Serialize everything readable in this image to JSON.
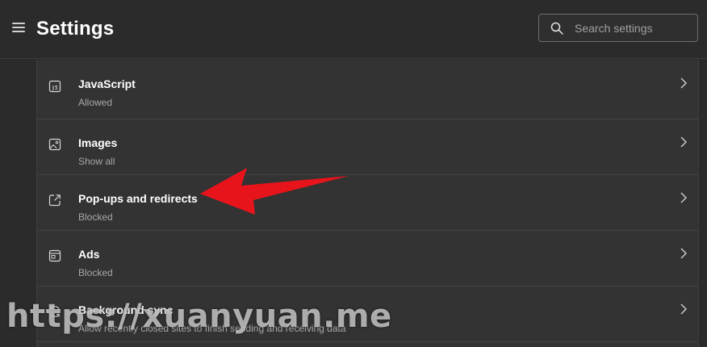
{
  "header": {
    "title": "Settings",
    "search_placeholder": "Search settings",
    "search_value": ""
  },
  "rows": [
    {
      "title": "JavaScript",
      "status": "Allowed",
      "icon": "javascript-icon"
    },
    {
      "title": "Images",
      "status": "Show all",
      "icon": "image-icon"
    },
    {
      "title": "Pop-ups and redirects",
      "status": "Blocked",
      "icon": "popup-redirect-icon"
    },
    {
      "title": "Ads",
      "status": "Blocked",
      "icon": "ads-icon"
    },
    {
      "title": "Background sync",
      "status": "Allow recently closed sites to finish sending and receiving data",
      "icon": "sync-icon"
    }
  ],
  "annotation": {
    "arrow_color": "#e8141b"
  },
  "watermark": {
    "text": "https://xuanyuan.me"
  },
  "colors": {
    "background": "#2b2b2b",
    "panel": "#333333",
    "divider": "#444444",
    "secondary_text": "#a8a8a8"
  }
}
